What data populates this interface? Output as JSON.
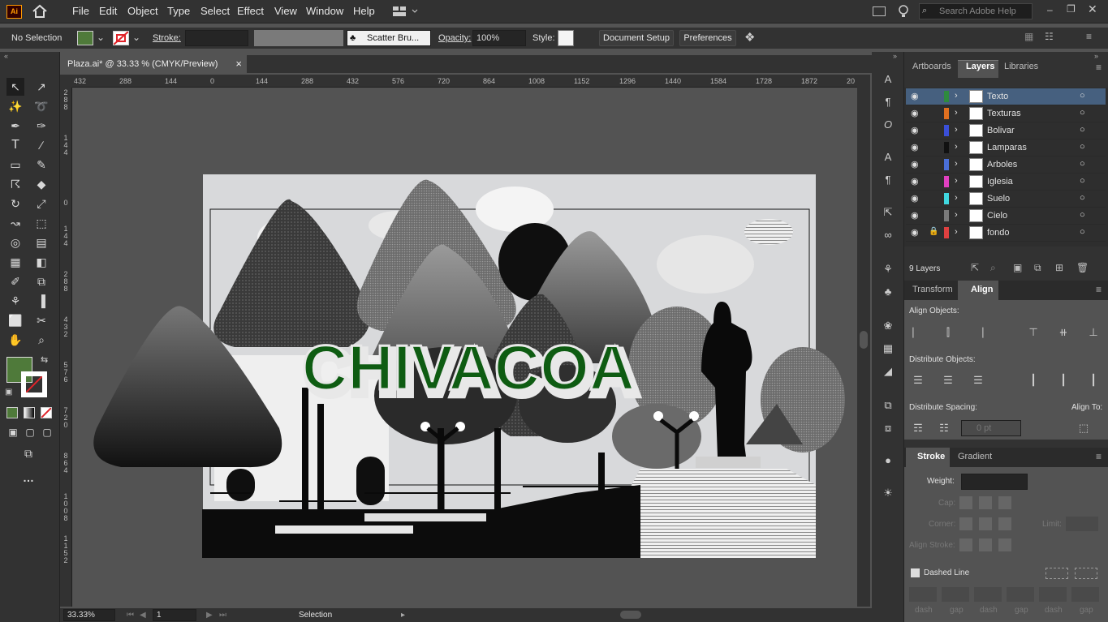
{
  "app": {
    "logo": "Ai",
    "menu": [
      "File",
      "Edit",
      "Object",
      "Type",
      "Select",
      "Effect",
      "View",
      "Window",
      "Help"
    ],
    "search_placeholder": "Search Adobe Help"
  },
  "control": {
    "selection": "No Selection",
    "stroke_label": "Stroke:",
    "brush": "Scatter Bru...",
    "opacity_label": "Opacity:",
    "opacity": "100%",
    "style_label": "Style:",
    "document_setup": "Document Setup",
    "preferences": "Preferences",
    "fill_color": "#4f7a3a",
    "stroke_none_color": "#e0242a"
  },
  "document": {
    "tab_title": "Plaza.ai* @ 33.33 % (CMYK/Preview)",
    "close": "×"
  },
  "ruler": {
    "h": [
      "432",
      "288",
      "144",
      "0",
      "144",
      "288",
      "432",
      "576",
      "720",
      "864",
      "1008",
      "1152",
      "1296",
      "1440",
      "1584",
      "1728",
      "1872",
      "20"
    ],
    "v": [
      [
        "2",
        "8",
        "8"
      ],
      [
        "1",
        "4",
        "4"
      ],
      [
        "0"
      ],
      [
        "1",
        "4",
        "4"
      ],
      [
        "2",
        "8",
        "8"
      ],
      [
        "4",
        "3",
        "2"
      ],
      [
        "5",
        "7",
        "6"
      ],
      [
        "7",
        "2",
        "0"
      ],
      [
        "8",
        "6",
        "4"
      ],
      [
        "1",
        "0",
        "0",
        "8"
      ],
      [
        "1",
        "1",
        "5",
        "2"
      ]
    ]
  },
  "artwork": {
    "headline": "CHIVACOA",
    "headline_color": "#0e5c12"
  },
  "status": {
    "zoom": "33.33%",
    "page": "1",
    "tool": "Selection"
  },
  "panels": {
    "top_tabs": [
      "Artboards",
      "Layers",
      "Libraries"
    ],
    "layers": [
      {
        "name": "Texto",
        "color": "#2e8b3e",
        "selected": true,
        "locked": false
      },
      {
        "name": "Texturas",
        "color": "#e07020",
        "selected": false,
        "locked": false
      },
      {
        "name": "Bolivar",
        "color": "#3a4fd8",
        "selected": false,
        "locked": false
      },
      {
        "name": "Lamparas",
        "color": "#111111",
        "selected": false,
        "locked": false
      },
      {
        "name": "Arboles",
        "color": "#4a6fd8",
        "selected": false,
        "locked": false
      },
      {
        "name": "Iglesia",
        "color": "#e040c0",
        "selected": false,
        "locked": false
      },
      {
        "name": "Suelo",
        "color": "#40d8e0",
        "selected": false,
        "locked": false
      },
      {
        "name": "Cielo",
        "color": "#7a7a7a",
        "selected": false,
        "locked": false
      },
      {
        "name": "fondo",
        "color": "#e04040",
        "selected": false,
        "locked": true
      }
    ],
    "layer_count": "9 Layers",
    "align_tabs": [
      "Transform",
      "Align"
    ],
    "align_objects": "Align Objects:",
    "distribute_objects": "Distribute Objects:",
    "distribute_spacing": "Distribute Spacing:",
    "align_to": "Align To:",
    "spacing_value": "0 pt",
    "stroke_tabs": [
      "Stroke",
      "Gradient"
    ],
    "weight_label": "Weight:",
    "cap_label": "Cap:",
    "corner_label": "Corner:",
    "limit_label": "Limit:",
    "align_stroke_label": "Align Stroke:",
    "dashed_label": "Dashed Line",
    "dash_labels": [
      "dash",
      "gap",
      "dash",
      "gap",
      "dash",
      "gap"
    ]
  }
}
